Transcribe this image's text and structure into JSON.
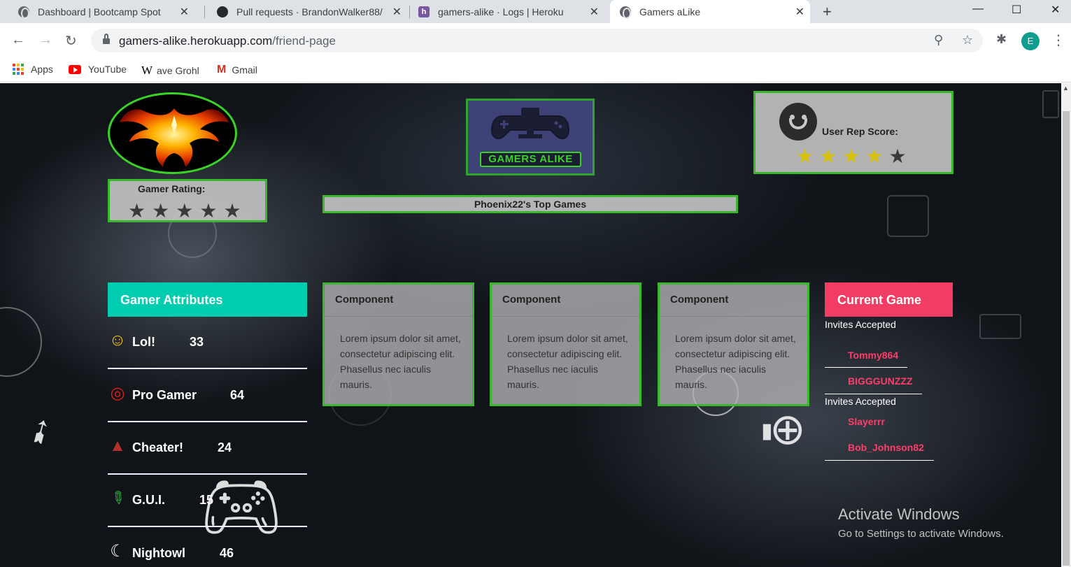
{
  "browser": {
    "tabs": [
      {
        "title": "Dashboard | Bootcamp Spot",
        "icon": "globe-icon",
        "active": false
      },
      {
        "title": "Pull requests · BrandonWalker88/",
        "icon": "github-icon",
        "active": false
      },
      {
        "title": "gamers-alike · Logs | Heroku",
        "icon": "heroku-icon",
        "active": false
      },
      {
        "title": "Gamers aLike",
        "icon": "globe-icon",
        "active": true
      }
    ],
    "url_host": "gamers-alike.herokuapp.com",
    "url_path": "/friend-page",
    "profile_initial": "E",
    "bookmarks": [
      {
        "label": "Apps",
        "icon": "apps-grid-icon"
      },
      {
        "label": "YouTube",
        "icon": "youtube-icon"
      },
      {
        "label": "ave Grohl",
        "icon": "wikipedia-icon",
        "icon_text": "W"
      },
      {
        "label": "Gmail",
        "icon": "gmail-icon",
        "icon_text": "M"
      }
    ]
  },
  "page": {
    "brand_text": "GAMERS ALIKE",
    "gamer_rating": {
      "label": "Gamer Rating:",
      "stars_filled": 0,
      "stars_total": 5
    },
    "rep_score": {
      "label": "User Rep Score:",
      "stars_filled": 4,
      "stars_total": 5
    },
    "top_games_title": "Phoenix22's Top Games",
    "attributes_title": "Gamer Attributes",
    "attributes": [
      {
        "label": "Lol!",
        "value": "33",
        "icon": "laughing-face-icon"
      },
      {
        "label": "Pro Gamer",
        "value": "64",
        "icon": "bullseye-icon"
      },
      {
        "label": "Cheater!",
        "value": "24",
        "icon": "poop-icon"
      },
      {
        "label": "G.U.I.",
        "value": "15",
        "icon": "bottle-icon"
      },
      {
        "label": "Nightowl",
        "value": "46",
        "icon": "moon-icon"
      }
    ],
    "cards": [
      {
        "title": "Component",
        "body": "Lorem ipsum dolor sit amet, consectetur adipiscing elit. Phasellus nec iaculis mauris."
      },
      {
        "title": "Component",
        "body": "Lorem ipsum dolor sit amet, consectetur adipiscing elit. Phasellus nec iaculis mauris."
      },
      {
        "title": "Component",
        "body": "Lorem ipsum dolor sit amet, consectetur adipiscing elit. Phasellus nec iaculis mauris."
      }
    ],
    "current_game": {
      "title": "Current Game",
      "groups": [
        {
          "label": "Invites Accepted",
          "names": [
            "Tommy864",
            "BIGGGUNZZZ"
          ]
        },
        {
          "label": "Invites Accepted",
          "names": [
            "Slayerrr",
            "Bob_Johnson82"
          ]
        }
      ]
    },
    "colors": {
      "accent_green": "#39b82b",
      "teal": "#00cdb0",
      "pink": "#f13c63",
      "star_yellow": "#d8c30a",
      "star_dark": "#3a3a3a"
    }
  },
  "windows_watermark": {
    "title": "Activate Windows",
    "subtitle": "Go to Settings to activate Windows."
  }
}
